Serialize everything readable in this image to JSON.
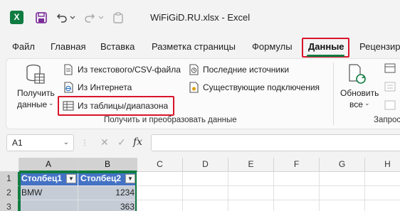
{
  "app": {
    "title": "WiFiGiD.RU.xlsx  -  Excel",
    "logo_letter": "X",
    "icons": [
      "excel-logo-icon",
      "save-icon",
      "undo-icon",
      "undo-dropdown-icon",
      "redo-icon",
      "redo-dropdown-icon",
      "clipboard-icon"
    ]
  },
  "tabs": [
    {
      "label": "Файл"
    },
    {
      "label": "Главная"
    },
    {
      "label": "Вставка"
    },
    {
      "label": "Разметка страницы"
    },
    {
      "label": "Формулы"
    },
    {
      "label": "Данные",
      "active": true
    },
    {
      "label": "Рецензир"
    }
  ],
  "ribbon": {
    "get_data_line1": "Получить",
    "get_data_line2": "данные",
    "from_text_csv": "Из текстового/CSV-файла",
    "from_web": "Из Интернета",
    "from_table": "Из таблицы/диапазона",
    "recent_sources": "Последние источники",
    "existing_connections": "Существующие подключения",
    "group_label": "Получить и преобразовать данные",
    "refresh_line1": "Обновить",
    "refresh_line2": "все",
    "group2_label": "Запрос"
  },
  "formula_bar": {
    "name_box": "A1",
    "fx": "fx",
    "formula": ""
  },
  "grid": {
    "columns": [
      "A",
      "B",
      "C",
      "D",
      "E",
      "F",
      "G",
      "H"
    ],
    "rows": [
      "1",
      "2",
      "3"
    ],
    "cells": {
      "A1": "Столбец1",
      "B1": "Столбец2",
      "A2": "BMW",
      "B2": "1234",
      "A3": "",
      "B3": "363"
    }
  },
  "colors": {
    "accent": "#107c41",
    "highlight": "#d9142a",
    "table_header": "#4472c4"
  }
}
